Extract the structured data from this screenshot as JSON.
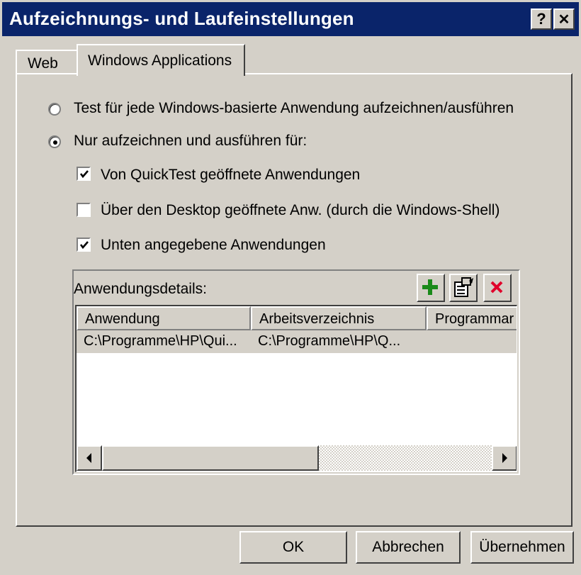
{
  "window": {
    "title": "Aufzeichnungs- und Laufeinstellungen",
    "help_label": "?",
    "close_label": "✕"
  },
  "tabs": [
    {
      "label": "Web",
      "selected": false
    },
    {
      "label": "Windows Applications",
      "selected": true
    }
  ],
  "options": {
    "radio_all_label": "Test für jede Windows-basierte Anwendung aufzeichnen/ausführen",
    "radio_all_selected": false,
    "radio_only_label": "Nur aufzeichnen und ausführen für:",
    "radio_only_selected": true,
    "check_quicktest_label": "Von QuickTest geöffnete Anwendungen",
    "check_quicktest_checked": true,
    "check_desktop_label": "Über den Desktop geöffnete Anw. (durch die Windows-Shell)",
    "check_desktop_checked": false,
    "check_below_label": "Unten angegebene Anwendungen",
    "check_below_checked": true
  },
  "app_details": {
    "label": "Anwendungsdetails:",
    "toolbar": [
      {
        "icon": "add-icon",
        "color": "#1a8a1a"
      },
      {
        "icon": "properties-icon",
        "color": "#000000"
      },
      {
        "icon": "delete-icon",
        "color": "#e0002a"
      }
    ],
    "columns": [
      "Anwendung",
      "Arbeitsverzeichnis",
      "Programmar"
    ],
    "rows": [
      {
        "application": "C:\\Programme\\HP\\Qui...",
        "working_dir": "C:\\Programme\\HP\\Q...",
        "program": ""
      }
    ]
  },
  "buttons": {
    "ok": "OK",
    "cancel": "Abbrechen",
    "apply": "Übernehmen"
  },
  "colors": {
    "titlebar": "#0a246a",
    "face": "#d4d0c8"
  }
}
